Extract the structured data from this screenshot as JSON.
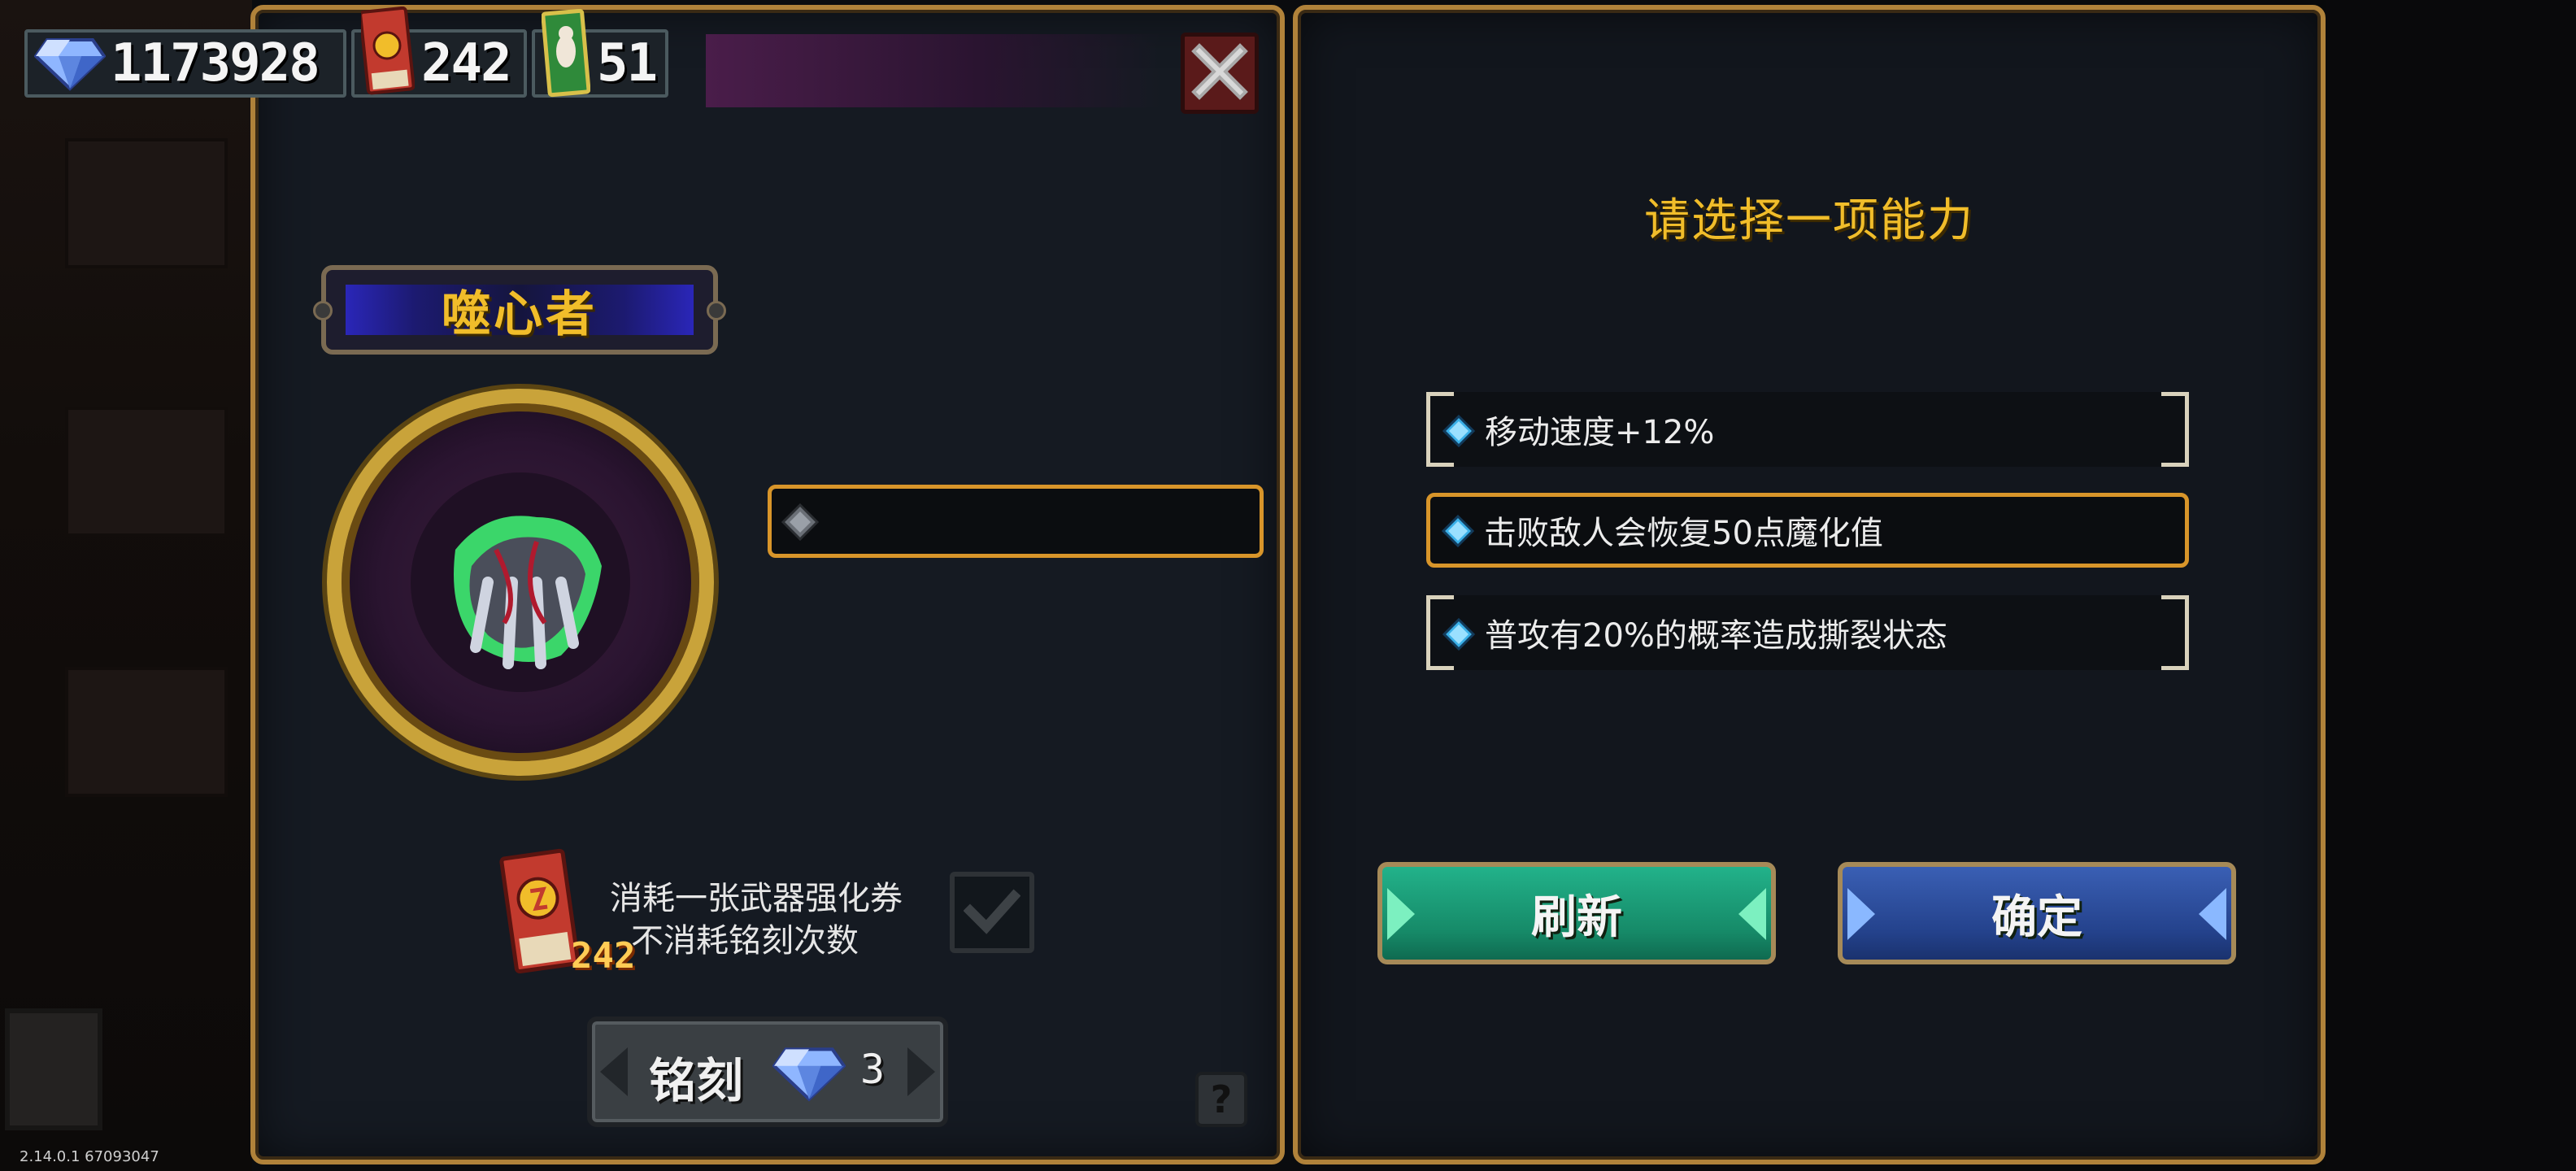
{
  "currency": {
    "gems": "1173928",
    "weapon_tickets": "242",
    "cards": "51"
  },
  "weapon": {
    "name": "噬心者"
  },
  "upgrade_ticket": {
    "line1": "消耗一张武器强化券",
    "line2": "不消耗铭刻次数",
    "count": "242"
  },
  "engrave": {
    "label": "铭刻",
    "cost": "3"
  },
  "help": {
    "label": "?"
  },
  "right": {
    "title": "请选择一项能力",
    "abilities": [
      {
        "text": "移动速度+12%"
      },
      {
        "text": "击败敌人会恢复50点魔化值"
      },
      {
        "text": "普攻有20%的概率造成撕裂状态"
      }
    ],
    "selected_index": 1,
    "refresh_label": "刷新",
    "confirm_label": "确定"
  },
  "version": "2.14.0.1 67093047",
  "colors": {
    "frame_gold": "#b0823a",
    "title_yellow": "#f1bd2a",
    "refresh_green": "#22b28a",
    "confirm_blue": "#3a5fb4",
    "selected_orange": "#d8952a"
  }
}
